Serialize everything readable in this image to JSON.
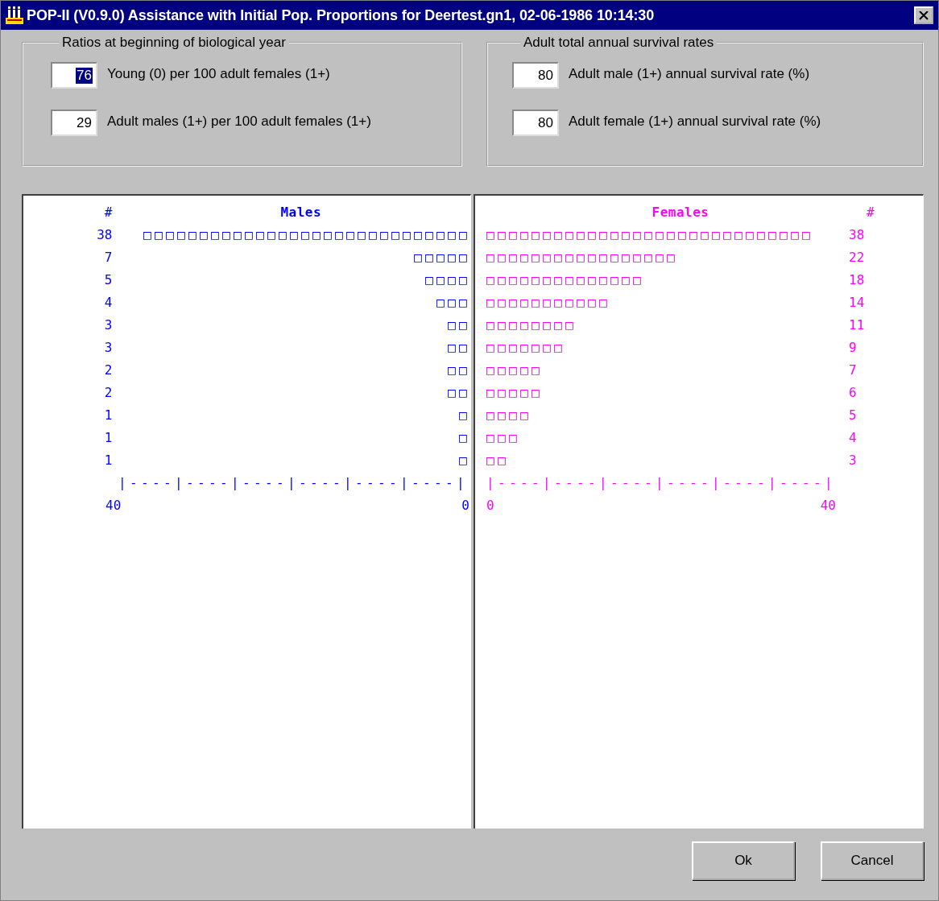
{
  "window": {
    "title": "POP-II (V0.9.0) Assistance with Initial Pop. Proportions for Deertest.gn1, 02-06-1986 10:14:30"
  },
  "groups": [
    {
      "title": "Ratios at beginning of biological year",
      "fields": [
        {
          "value": "76",
          "label": "Young (0) per 100 adult females (1+)",
          "selected": true
        },
        {
          "value": "29",
          "label": "Adult males (1+) per 100 adult females (1+)",
          "selected": false
        }
      ]
    },
    {
      "title": "Adult total annual survival rates",
      "fields": [
        {
          "value": "80",
          "label": "Adult male (1+) annual survival rate (%)",
          "selected": false
        },
        {
          "value": "80",
          "label": "Adult female (1+) annual survival rate (%)",
          "selected": false
        }
      ]
    }
  ],
  "histograms": [
    {
      "kind": "left",
      "color": "#0000ff",
      "count_header": "#",
      "title": "Males",
      "rows": [
        {
          "count": "38",
          "bar": "□□□□□□□□□□□□□□□□□□□□□□□□□□□□□"
        },
        {
          "count": "7",
          "bar": "□□□□□"
        },
        {
          "count": "5",
          "bar": "□□□□"
        },
        {
          "count": "4",
          "bar": "□□□"
        },
        {
          "count": "3",
          "bar": "□□"
        },
        {
          "count": "3",
          "bar": "□□"
        },
        {
          "count": "2",
          "bar": "□□"
        },
        {
          "count": "2",
          "bar": "□□"
        },
        {
          "count": "1",
          "bar": "□"
        },
        {
          "count": "1",
          "bar": "□"
        },
        {
          "count": "1",
          "bar": "□"
        }
      ],
      "axis": "|----|----|----|----|----|----|",
      "scale_start": "40",
      "scale_end": "0"
    },
    {
      "kind": "right",
      "color": "#ff00ff",
      "count_header": "#",
      "title": "Females",
      "rows": [
        {
          "count": "38",
          "bar": "□□□□□□□□□□□□□□□□□□□□□□□□□□□□□"
        },
        {
          "count": "22",
          "bar": "□□□□□□□□□□□□□□□□□"
        },
        {
          "count": "18",
          "bar": "□□□□□□□□□□□□□□"
        },
        {
          "count": "14",
          "bar": "□□□□□□□□□□□"
        },
        {
          "count": "11",
          "bar": "□□□□□□□□"
        },
        {
          "count": "9",
          "bar": "□□□□□□□"
        },
        {
          "count": "7",
          "bar": "□□□□□"
        },
        {
          "count": "6",
          "bar": "□□□□□"
        },
        {
          "count": "5",
          "bar": "□□□□"
        },
        {
          "count": "4",
          "bar": "□□□"
        },
        {
          "count": "3",
          "bar": "□□"
        }
      ],
      "axis": "|----|----|----|----|----|----|",
      "scale_start": "0",
      "scale_end": "40"
    }
  ],
  "buttons": [
    "Ok",
    "Cancel"
  ]
}
